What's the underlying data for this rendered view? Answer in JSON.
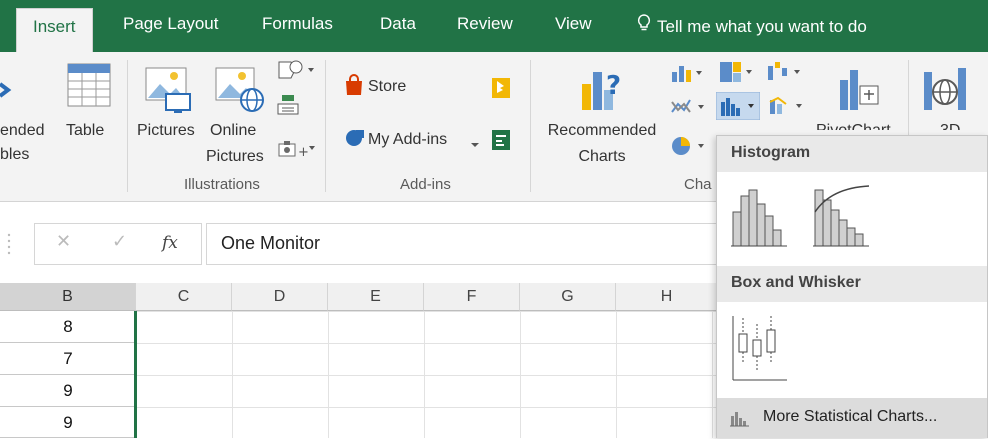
{
  "tabs": {
    "insert": "Insert",
    "page_layout": "Page Layout",
    "formulas": "Formulas",
    "data": "Data",
    "review": "Review",
    "view": "View",
    "tell_me": "Tell me what you want to do"
  },
  "ribbon": {
    "recommended_tables_l1": "ended",
    "recommended_tables_l2": "bles",
    "table": "Table",
    "pictures": "Pictures",
    "online_pictures_l1": "Online",
    "online_pictures_l2": "Pictures",
    "store": "Store",
    "my_addins": "My Add-ins",
    "recommended_charts_l1": "Recommended",
    "recommended_charts_l2": "Charts",
    "pivotchart": "PivotChart",
    "three_d": "3D",
    "group_illustrations": "Illustrations",
    "group_addins": "Add-ins",
    "group_charts": "Cha"
  },
  "formula_bar": {
    "fx": "fx",
    "value": "One Monitor"
  },
  "grid": {
    "columns": [
      "B",
      "C",
      "D",
      "E",
      "F",
      "G",
      "H"
    ],
    "rows_B": [
      "8",
      "7",
      "9",
      "9"
    ]
  },
  "dropdown": {
    "histogram_header": "Histogram",
    "box_whisker_header": "Box and Whisker",
    "more_charts": "More Statistical Charts...",
    "accent": "#217346"
  }
}
